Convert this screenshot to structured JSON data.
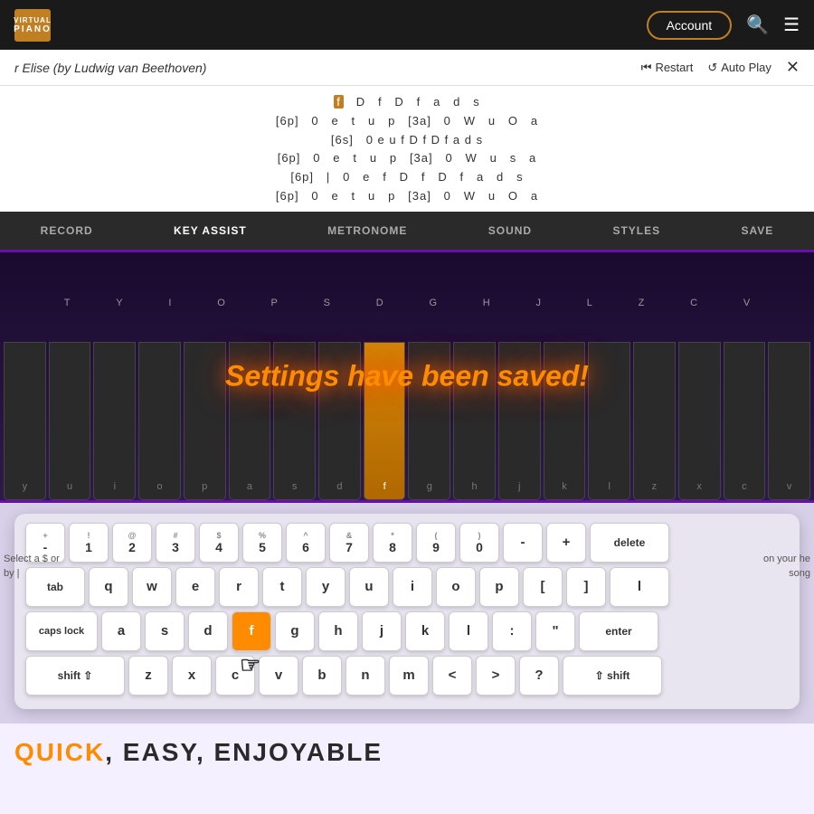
{
  "header": {
    "logo_line1": "VIRTUAL",
    "logo_line2": "PIANO",
    "account_label": "Account",
    "search_icon": "🔍",
    "menu_icon": "☰"
  },
  "song_bar": {
    "title": "r Elise (by Ludwig van Beethoven)",
    "restart_label": "Restart",
    "autoplay_label": "Auto Play",
    "close_icon": "✕"
  },
  "sheet_music": {
    "lines": [
      "f  D  f  D  f  a  d  s",
      "[6p]  0  e  t  u  p  [3a]  0  W  u  O  a",
      "[6s]  0 e u f D f D f a d s",
      "[6p]  0  e  t  u  p  [3a]  0  W  u  s  a",
      "[6p]  |  0  e  f  D  f  D  f  a  d  s",
      "[6p]  0  e  t  u  p  [3a]  0  W  u  O  a"
    ],
    "highlighted_char": "f"
  },
  "toolbar": {
    "items": [
      "RECORD",
      "KEY ASSIST",
      "METRONOME",
      "SOUND",
      "STYLES",
      "SAVE"
    ],
    "active_index": 1
  },
  "piano": {
    "settings_saved_msg": "Settings have been saved!",
    "top_labels": [
      "T",
      "Y",
      "I",
      "O",
      "P",
      "S",
      "D",
      "G",
      "H",
      "J",
      "L",
      "Z",
      "C",
      "V"
    ],
    "bottom_labels": [
      "y",
      "u",
      "i",
      "o",
      "p",
      "a",
      "s",
      "d",
      "f",
      "g",
      "h",
      "j",
      "k",
      "l",
      "z",
      "x",
      "c",
      "v"
    ],
    "highlighted_bottom": "f"
  },
  "on_screen_keyboard": {
    "row1": [
      {
        "label": "+\n-",
        "sub": "",
        "main": "+\n-",
        "wide": false
      },
      {
        "label": "!\n1",
        "sub": "!",
        "main": "1"
      },
      {
        "label": "@\n2",
        "sub": "@",
        "main": "2"
      },
      {
        "label": "#\n3",
        "sub": "#",
        "main": "3"
      },
      {
        "label": "$\n4",
        "sub": "$",
        "main": "4"
      },
      {
        "label": "%\n5",
        "sub": "%",
        "main": "5"
      },
      {
        "label": "^\n6",
        "sub": "^",
        "main": "6"
      },
      {
        "label": "&\n7",
        "sub": "&",
        "main": "7"
      },
      {
        "label": "*\n8",
        "sub": "*",
        "main": "8"
      },
      {
        "label": "(\n9",
        "sub": "(",
        "main": "9"
      },
      {
        "label": ")\n0",
        "sub": ")",
        "main": "0"
      },
      {
        "label": "-",
        "sub": "",
        "main": "-"
      },
      {
        "label": "+",
        "sub": "",
        "main": "+"
      },
      {
        "label": "delete",
        "sub": "",
        "main": "delete",
        "wide": true
      }
    ],
    "row2": [
      {
        "label": "tab",
        "sub": "",
        "main": "tab",
        "wide": true
      },
      {
        "label": "q"
      },
      {
        "label": "w"
      },
      {
        "label": "e"
      },
      {
        "label": "r"
      },
      {
        "label": "t"
      },
      {
        "label": "y"
      },
      {
        "label": "u"
      },
      {
        "label": "i"
      },
      {
        "label": "o"
      },
      {
        "label": "p"
      },
      {
        "label": "["
      },
      {
        "label": "]"
      },
      {
        "label": "l",
        "wide": true
      }
    ],
    "row3": [
      {
        "label": "caps lock",
        "wide": true
      },
      {
        "label": "a"
      },
      {
        "label": "s"
      },
      {
        "label": "d"
      },
      {
        "label": "f",
        "highlighted": true
      },
      {
        "label": "g"
      },
      {
        "label": "h"
      },
      {
        "label": "j"
      },
      {
        "label": "k"
      },
      {
        "label": "l"
      },
      {
        "label": ":"
      },
      {
        "label": "\""
      },
      {
        "label": "enter",
        "wide": true
      }
    ],
    "row4": [
      {
        "label": "shift ⇧",
        "wide": true
      },
      {
        "label": "z"
      },
      {
        "label": "x"
      },
      {
        "label": "c"
      },
      {
        "label": "v"
      },
      {
        "label": "b"
      },
      {
        "label": "n"
      },
      {
        "label": "m"
      },
      {
        "label": "<"
      },
      {
        "label": ">"
      },
      {
        "label": "?"
      },
      {
        "label": "⇧ shift",
        "wide": true
      }
    ]
  },
  "side_texts": {
    "left": "Select a $ or by |",
    "right": "on your he song"
  },
  "bottom": {
    "title_part1": "QUICK, EASY, ENJOYABLE"
  }
}
